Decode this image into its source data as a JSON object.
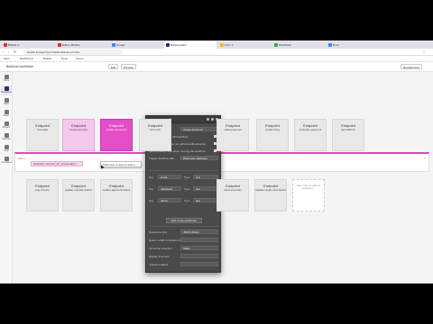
{
  "browser": {
    "tabs": [
      {
        "label": "Bubble.io",
        "fav": "#d93025",
        "active": false
      },
      {
        "label": "Editor | Bubble",
        "fav": "#d93025",
        "active": false
      },
      {
        "label": "Google",
        "fav": "#4285f4",
        "active": false
      },
      {
        "label": "Bubble Editor",
        "fav": "#2b2b6e",
        "active": true
      },
      {
        "label": "Form 2",
        "fav": "#fbbc05",
        "active": false
      },
      {
        "label": "Workflows",
        "fav": "#34a853",
        "active": false
      },
      {
        "label": "Docs",
        "fav": "#4285f4",
        "active": false
      }
    ],
    "url": "bubble.io/page?type=backend&name=index",
    "bookmarks": [
      "Apps",
      "Dashboard",
      "Bubble",
      "Docs",
      "Forum"
    ]
  },
  "app": {
    "name": "Backend workflows",
    "buttons": [
      "Edit",
      "Preview",
      "Development"
    ]
  },
  "sidebar": {
    "items": [
      {
        "label": "Home",
        "active": false
      },
      {
        "label": "Workflows",
        "active": true
      },
      {
        "label": "Data",
        "active": false
      },
      {
        "label": "Styles",
        "active": false
      },
      {
        "label": "Plugins",
        "active": false
      },
      {
        "label": "Settings",
        "active": false
      },
      {
        "label": "Logs",
        "active": false
      },
      {
        "label": "Templates",
        "active": false
      }
    ]
  },
  "cards_top": [
    {
      "title": "Endpoint",
      "sub": "new-task",
      "style": "normal"
    },
    {
      "title": "Endpoint",
      "sub": "create-account",
      "style": "pink"
    },
    {
      "title": "Endpoint",
      "sub": "create-account-2",
      "style": "magenta"
    },
    {
      "title": "Endpoint",
      "sub": "form-sub",
      "style": "normal"
    },
    {
      "title": "Endpoint",
      "sub": "make-payment",
      "style": "normal"
    },
    {
      "title": "Endpoint",
      "sub": "create-thing",
      "style": "normal"
    },
    {
      "title": "Endpoint",
      "sub": "schedule-payment",
      "style": "normal"
    },
    {
      "title": "Endpoint",
      "sub": "get-address",
      "style": "normal"
    }
  ],
  "strip": {
    "tag": "Event",
    "input_value": "Endpoint: account_for_presentation",
    "input2_value": "Click here to add an action..."
  },
  "cards_bottom": [
    {
      "title": "Endpoint",
      "sub": "pay-invoice",
      "style": "normal"
    },
    {
      "title": "Endpoint",
      "sub": "update-member-status",
      "style": "normal"
    },
    {
      "title": "Endpoint",
      "sub": "update-payment-status",
      "style": "normal"
    },
    {
      "title": "Endpoint",
      "sub": "send-summary",
      "style": "normal"
    },
    {
      "title": "Endpoint",
      "sub": "update-single-user-status",
      "style": "normal"
    },
    {
      "title": "",
      "sub": "Click here to add an endpoint...",
      "style": "white"
    }
  ],
  "panel": {
    "title": "create-account2",
    "rows": [
      {
        "label": "Endpoint name",
        "value": "create-account2"
      },
      {
        "label": "Expose as a public API workflow",
        "check": true
      },
      {
        "label": "This workflow can be run without authentication",
        "check": true
      },
      {
        "label": "Ignore privacy rules when running the workflow",
        "check": true
      },
      {
        "label": "Trigger workflow with",
        "value": "Parameter definition"
      }
    ],
    "params": [
      {
        "key": "Key",
        "name": "email",
        "type_label": "Type",
        "type": "text"
      },
      {
        "key": "Key",
        "name": "password",
        "type_label": "Type",
        "type": "text"
      },
      {
        "key": "Key",
        "name": "name",
        "type_label": "Type",
        "type": "text"
      }
    ],
    "add_label": "Add a new parameter",
    "bottom_rows": [
      {
        "label": "Response type",
        "value": "JSON Object"
      },
      {
        "label": "Return a 200 if condition is not met",
        "value": ""
      },
      {
        "label": "Timezone selection",
        "value": "Static"
      },
      {
        "label": "Display timezone",
        "value": ""
      },
      {
        "label": "Include headers",
        "value": ""
      }
    ]
  }
}
